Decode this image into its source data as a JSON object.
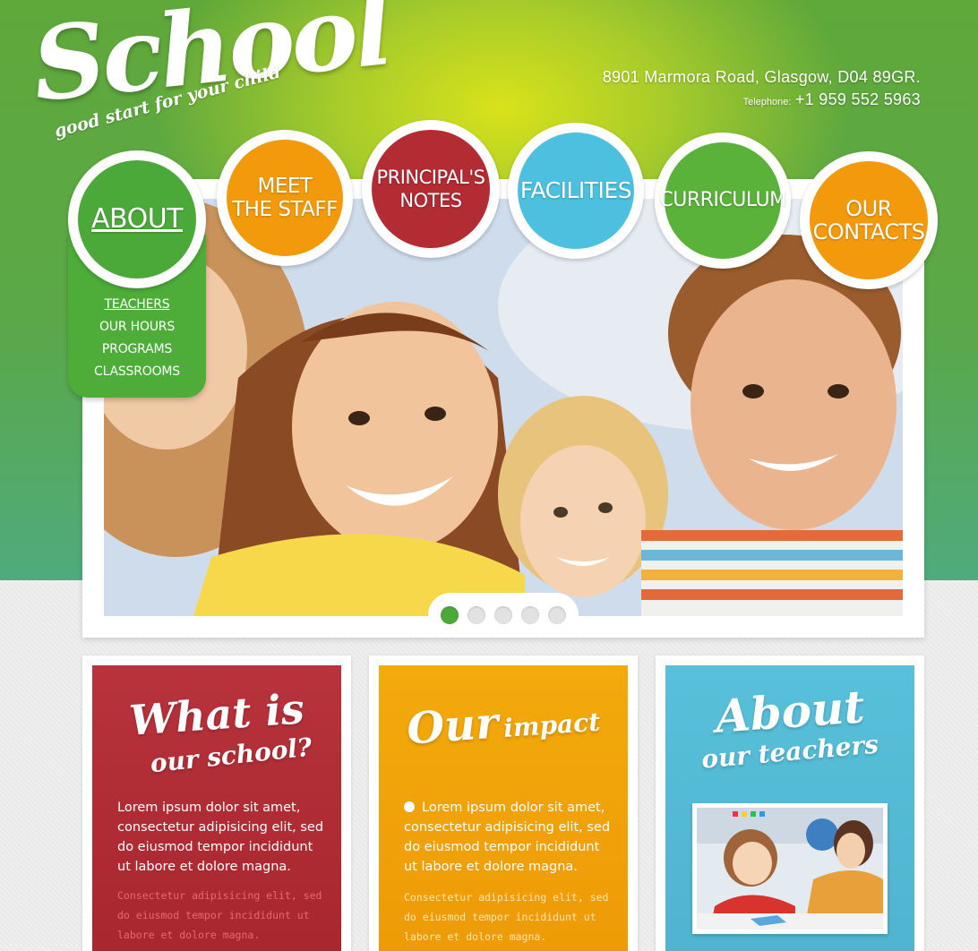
{
  "colors": {
    "green": "#4ba93a",
    "orange": "#f29a0c",
    "red": "#b32b33",
    "blue": "#4cc0de",
    "lime": "#5ab23a",
    "card_red": "#b3303a",
    "card_orange": "#f0a208",
    "card_blue": "#55bcd6"
  },
  "logo": {
    "word": "School",
    "tagline": "good start for your child"
  },
  "contact": {
    "address": "8901 Marmora Road, Glasgow,  D04 89GR.",
    "telephone_label": "Telephone:",
    "telephone": "+1 959 552 5963"
  },
  "nav": [
    {
      "label": "ABOUT",
      "color": "#4ba93a",
      "active": true
    },
    {
      "label": "MEET\nTHE STAFF",
      "color": "#f29a0c",
      "active": false
    },
    {
      "label": "PRINCIPAL'S\nNOTES",
      "color": "#b32b33",
      "active": false
    },
    {
      "label": "FACILITIES",
      "color": "#4cc0de",
      "active": false
    },
    {
      "label": "CURRICULUM",
      "color": "#5ab23a",
      "active": false
    },
    {
      "label": "OUR\nCONTACTS",
      "color": "#f29a0c",
      "active": false
    }
  ],
  "submenu": [
    "TEACHERS",
    "OUR HOURS",
    "PROGRAMS",
    "CLASSROOMS"
  ],
  "slider": {
    "slide_count": 5,
    "active_index": 0
  },
  "cards": [
    {
      "title_big": "What is",
      "title_small": "our school?",
      "body": "Lorem ipsum dolor sit amet, consectetur adipisicing elit, sed do eiusmod tempor incididunt ut labore et dolore magna.",
      "small": "Consectetur adipisicing elit, sed do eiusmod tempor incididunt ut labore et dolore magna."
    },
    {
      "title_big": "Our",
      "title_small": "impact",
      "body": "Lorem ipsum dolor sit amet, consectetur adipisicing elit, sed do eiusmod tempor incididunt ut labore et dolore magna.",
      "small": "Consectetur adipisicing elit, sed do eiusmod tempor incididunt ut labore et dolore magna."
    },
    {
      "title_big": "About",
      "title_small": "our teachers"
    }
  ]
}
